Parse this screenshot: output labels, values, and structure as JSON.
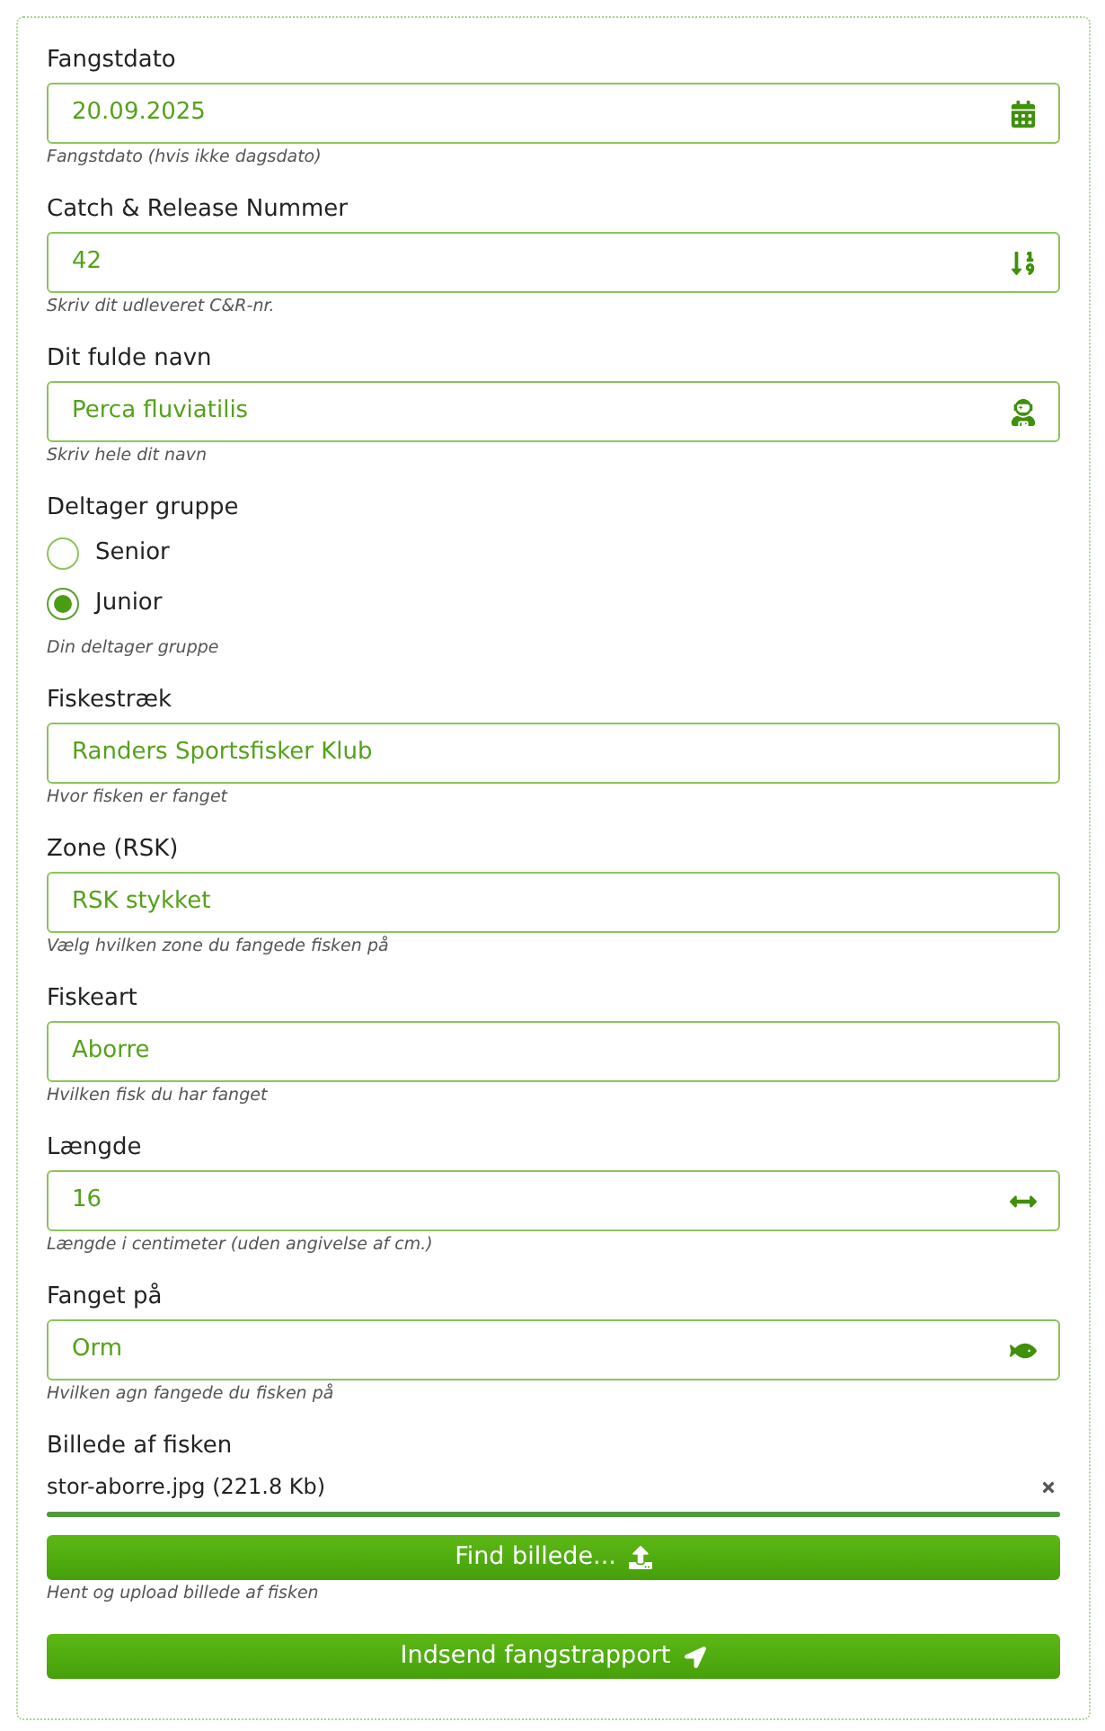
{
  "fields": [
    {
      "kind": "input",
      "label": "Fangstdato",
      "value": "20.09.2025",
      "help": "Fangstdato (hvis ikke dagsdato)"
    },
    {
      "kind": "input",
      "label": "Catch & Release Nummer",
      "value": "42",
      "help": "Skriv dit udleveret C&R-nr."
    },
    {
      "kind": "input",
      "label": "Dit fulde navn",
      "value": "Perca fluviatilis",
      "help": "Skriv hele dit navn"
    },
    {
      "kind": "radio",
      "label": "Deltager gruppe",
      "options": [
        {
          "label": "Senior",
          "selected": false
        },
        {
          "label": "Junior",
          "selected": true
        }
      ],
      "help": "Din deltager gruppe"
    },
    {
      "kind": "input",
      "label": "Fiskestræk",
      "value": "Randers Sportsfisker Klub",
      "help": "Hvor fisken er fanget"
    },
    {
      "kind": "input",
      "label": "Zone (RSK)",
      "value": "RSK stykket",
      "help": "Vælg hvilken zone du fangede fisken på"
    },
    {
      "kind": "input",
      "label": "Fiskeart",
      "value": "Aborre",
      "help": "Hvilken fisk du har fanget"
    },
    {
      "kind": "input",
      "label": "Længde",
      "value": "16",
      "help": "Længde i centimeter (uden angivelse af cm.)"
    },
    {
      "kind": "input",
      "label": "Fanget på",
      "value": "Orm",
      "help": "Hvilken agn fangede du fisken på"
    },
    {
      "kind": "upload",
      "label": "Billede af fisken",
      "file": "stor-aborre.jpg (221.8 Kb)",
      "level": 1,
      "button": "Find billede...",
      "help": "Hent og upload billede af fisken"
    }
  ],
  "submit": {
    "label": "Indsend fangstrapport"
  }
}
